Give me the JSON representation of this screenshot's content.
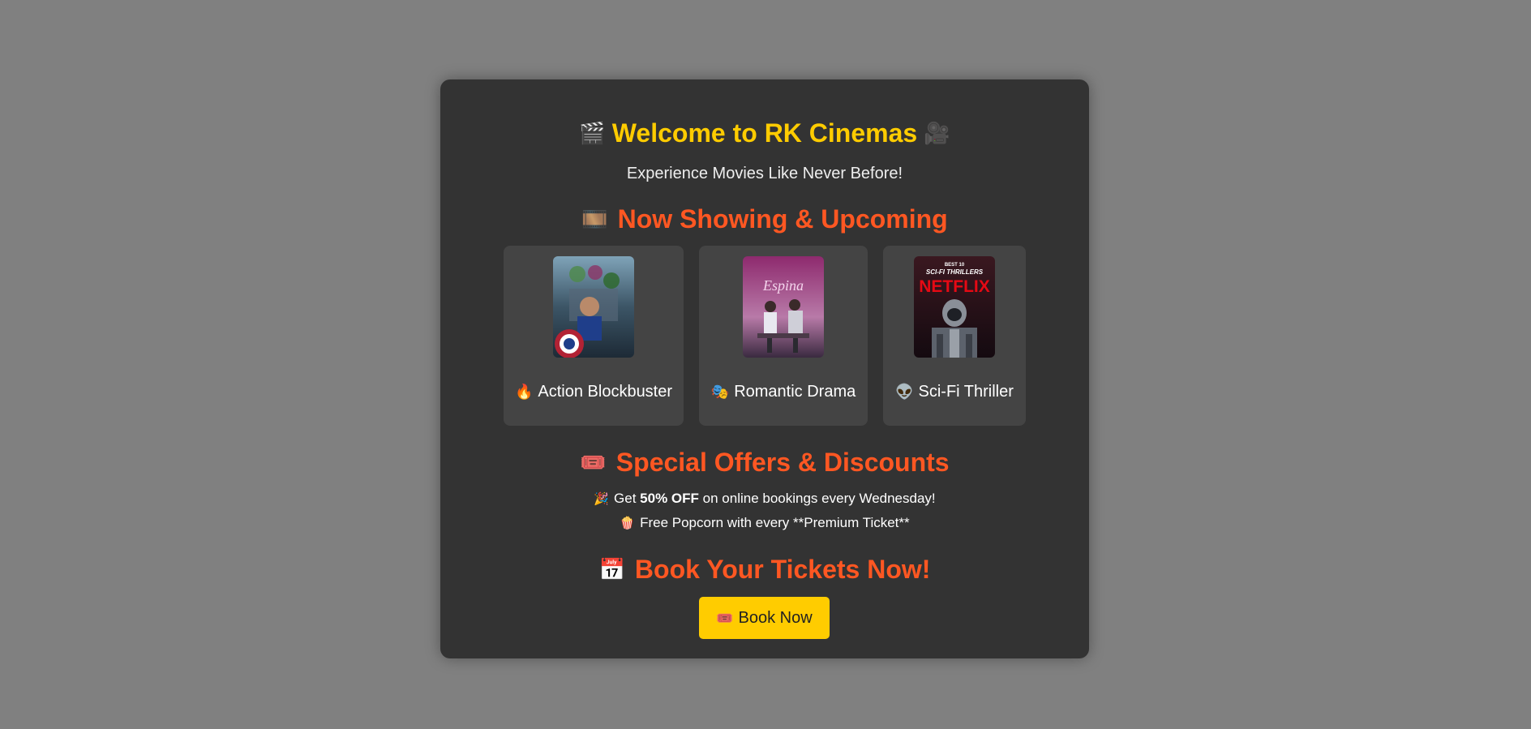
{
  "header": {
    "title_icon_left": "🎬",
    "title": "Welcome to RK Cinemas",
    "title_icon_right": "🎥",
    "subtitle": "Experience Movies Like Never Before!"
  },
  "movies_section": {
    "icon": "🎞️",
    "heading": "Now Showing & Upcoming",
    "movies": [
      {
        "icon": "🔥",
        "label": "Action Blockbuster",
        "poster_text": ""
      },
      {
        "icon": "🎭",
        "label": "Romantic Drama",
        "poster_text": "Espina"
      },
      {
        "icon": "👽",
        "label": "Sci-Fi Thriller",
        "poster_text_top": "BEST 10",
        "poster_text_mid": "SCI-FI THRILLERS",
        "poster_text_brand": "NETFLIX"
      }
    ]
  },
  "offers_section": {
    "icon": "🎟️",
    "heading": "Special Offers & Discounts",
    "offer1": {
      "icon": "🎉",
      "prefix": "Get",
      "highlight": "50% OFF",
      "suffix": "on online bookings every Wednesday!"
    },
    "offer2": {
      "icon": "🍿",
      "text": "Free Popcorn with every **Premium Ticket**"
    }
  },
  "booking_section": {
    "icon": "📅",
    "heading": "Book Your Tickets Now!",
    "button_icon": "🎟️",
    "button_label": "Book Now"
  },
  "colors": {
    "page_bg": "#808080",
    "card_bg": "#333333",
    "tile_bg": "#444444",
    "title": "#ffcc00",
    "section_heading": "#ff5722",
    "button_bg": "#ffcc00"
  }
}
